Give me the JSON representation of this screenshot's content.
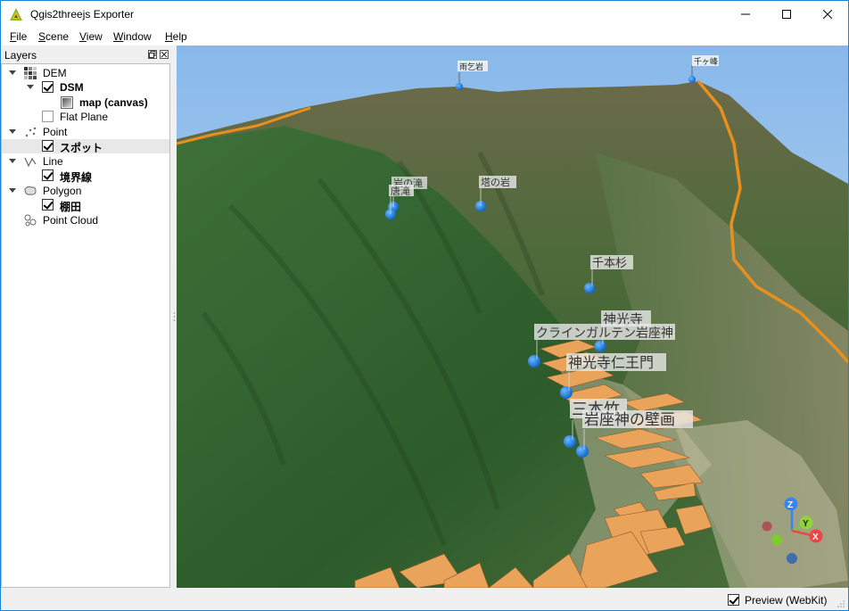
{
  "window": {
    "title": "Qgis2threejs Exporter"
  },
  "menu": [
    {
      "label": "File",
      "key": "F",
      "rest": "ile"
    },
    {
      "label": "Scene",
      "key": "S",
      "rest": "cene"
    },
    {
      "label": "View",
      "key": "V",
      "rest": "iew"
    },
    {
      "label": "Window",
      "key": "W",
      "rest": "indow"
    },
    {
      "label": "Help",
      "key": "H",
      "rest": "elp"
    }
  ],
  "layers_panel": {
    "title": "Layers",
    "items": [
      {
        "label": "DEM"
      },
      {
        "label": "DSM"
      },
      {
        "label": "map (canvas)"
      },
      {
        "label": "Flat Plane"
      },
      {
        "label": "Point"
      },
      {
        "label": "スポット"
      },
      {
        "label": "Line"
      },
      {
        "label": "境界線"
      },
      {
        "label": "Polygon"
      },
      {
        "label": "棚田"
      },
      {
        "label": "Point Cloud"
      }
    ]
  },
  "scene_labels": {
    "peak1": "雨乞岩",
    "peak2": "千ヶ峰",
    "l1": "岩の滝",
    "l2": "唐滝",
    "l3": "塔の岩",
    "l4": "千本杉",
    "l5": "神光寺",
    "l6": "クラインガルテン岩座神",
    "l7": "神光寺仁王門",
    "l8": "三本竹",
    "l9": "岩座神の壁画"
  },
  "axes": {
    "z": "Z",
    "y": "Y",
    "x": "X"
  },
  "colors": {
    "accent": "#1883d7",
    "boundary": "#e8901e",
    "terrace": "#e9a35a",
    "marker": "#1e88e5"
  },
  "status": {
    "preview_label": "Preview (WebKit)",
    "preview_checked": true
  }
}
